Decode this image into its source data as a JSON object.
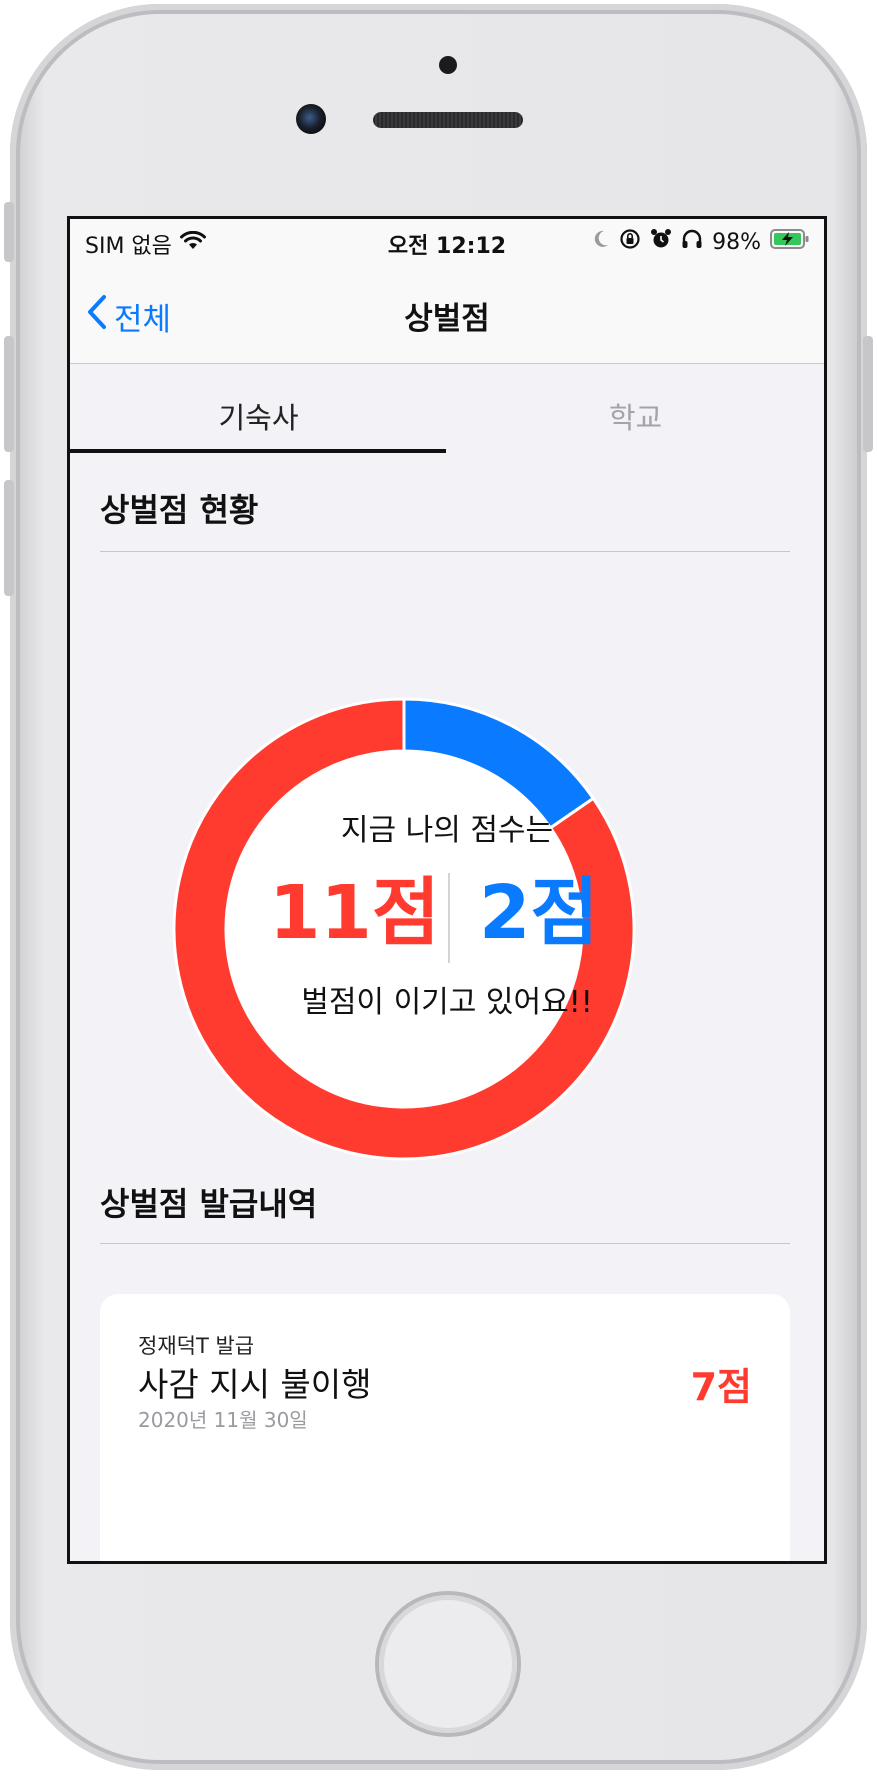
{
  "status_bar": {
    "carrier": "SIM 없음",
    "time": "오전 12:12",
    "battery": "98%"
  },
  "nav": {
    "back_label": "전체",
    "title": "상벌점"
  },
  "tabs": [
    {
      "label": "기숙사",
      "active": true
    },
    {
      "label": "학교",
      "active": false
    }
  ],
  "summary": {
    "section_title": "상벌점 현황",
    "headline": "지금 나의 점수는",
    "penalty_points": "11점",
    "reward_points": "2점",
    "message": "벌점이 이기고 있어요!!"
  },
  "chart_data": {
    "type": "pie",
    "values": [
      2,
      11
    ],
    "colors": [
      "#0a7aff",
      "#ff3b30"
    ]
  },
  "history": {
    "section_title": "상벌점 발급내역",
    "items": [
      {
        "issuer": "정재덕T 발급",
        "reason": "사감 지시 불이행",
        "points": "7점",
        "date": "2020년 11월 30일"
      }
    ]
  },
  "colors": {
    "accent": "#0a7aff",
    "penalty": "#ff3b30",
    "background": "#f2f2f7"
  }
}
